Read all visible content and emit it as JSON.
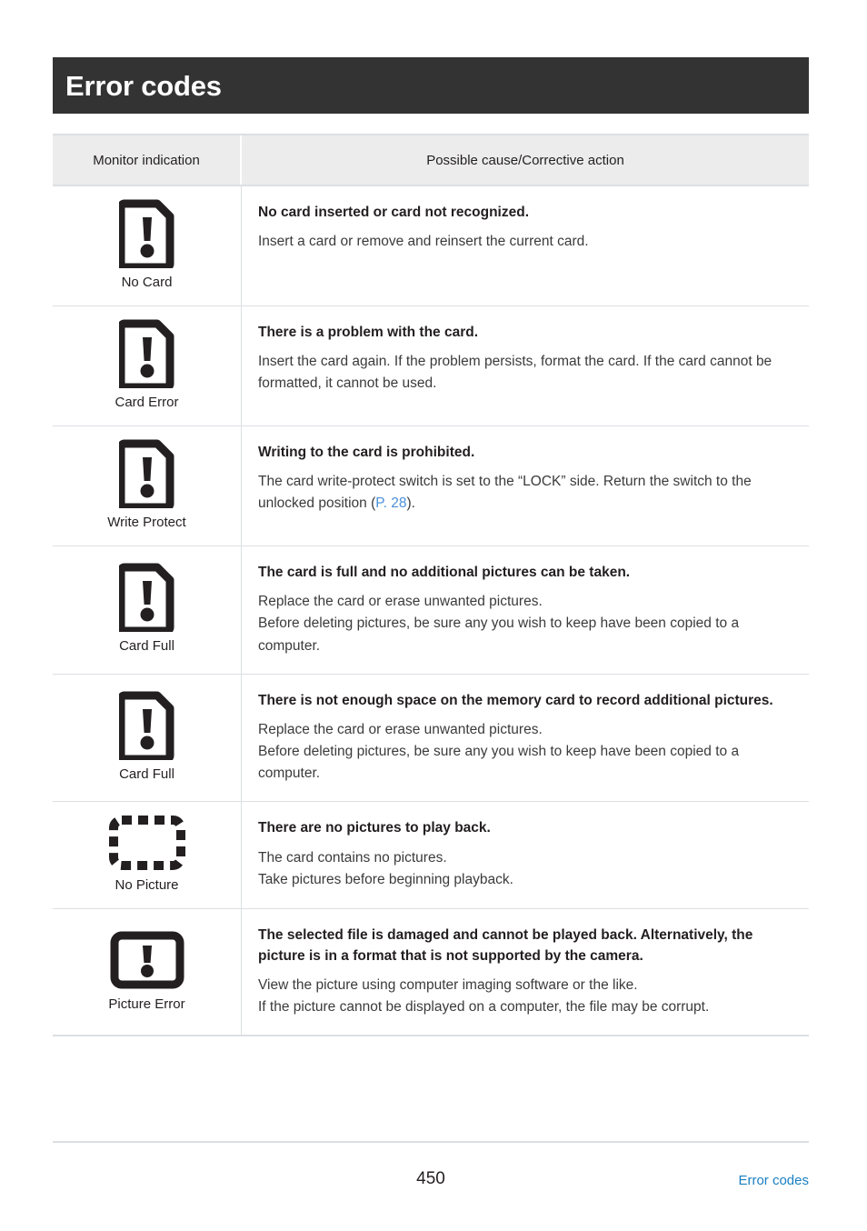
{
  "header": {
    "title": "Error codes"
  },
  "table": {
    "columns": {
      "monitor_indication": "Monitor indication",
      "possible_cause": "Possible cause/Corrective action"
    },
    "rows": [
      {
        "icon": "card-alert-icon",
        "icon_label": "No Card",
        "cause": "No card inserted or card not recognized.",
        "action_lines": [
          "Insert a card or remove and reinsert the current card."
        ]
      },
      {
        "icon": "card-alert-icon",
        "icon_label": "Card Error",
        "cause": "There is a problem with the card.",
        "action_lines": [
          "Insert the card again. If the problem persists, format the card. If the card cannot be formatted, it cannot be used."
        ]
      },
      {
        "icon": "card-alert-icon",
        "icon_label": "Write Protect",
        "cause": "Writing to the card is prohibited.",
        "action_prefix": "The card write-protect switch is set to the “LOCK” side. Return the switch to the unlocked position (",
        "action_link": "P. 28",
        "action_suffix": ")."
      },
      {
        "icon": "card-alert-icon",
        "icon_label": "Card Full",
        "cause": "The card is full and no additional pictures can be taken.",
        "action_lines": [
          "Replace the card or erase unwanted pictures.",
          "Before deleting pictures, be sure any you wish to keep have been copied to a computer."
        ]
      },
      {
        "icon": "card-alert-icon",
        "icon_label": "Card Full",
        "cause": "There is not enough space on the memory card to record additional pictures.",
        "action_lines": [
          "Replace the card or erase unwanted pictures.",
          "Before deleting pictures, be sure any you wish to keep have been copied to a computer."
        ]
      },
      {
        "icon": "dashed-frame-icon",
        "icon_label": "No Picture",
        "cause": "There are no pictures to play back.",
        "action_lines": [
          "The card contains no pictures.",
          "Take pictures before beginning playback."
        ]
      },
      {
        "icon": "picture-alert-icon",
        "icon_label": "Picture Error",
        "cause": "The selected file is damaged and cannot be played back. Alternatively, the picture is in a format that is not supported by the camera.",
        "action_lines": [
          "View the picture using computer imaging software or the like.",
          "If the picture cannot be displayed on a computer, the file may be corrupt."
        ]
      }
    ]
  },
  "footer": {
    "page_number": "450",
    "section_link": "Error codes"
  },
  "colors": {
    "header_bar": "#333333",
    "table_header_bg": "#ececec",
    "border": "#dcdfe3",
    "inline_link": "#4a90d9",
    "footer_link": "#1a7fc1",
    "text": "#231f20"
  }
}
